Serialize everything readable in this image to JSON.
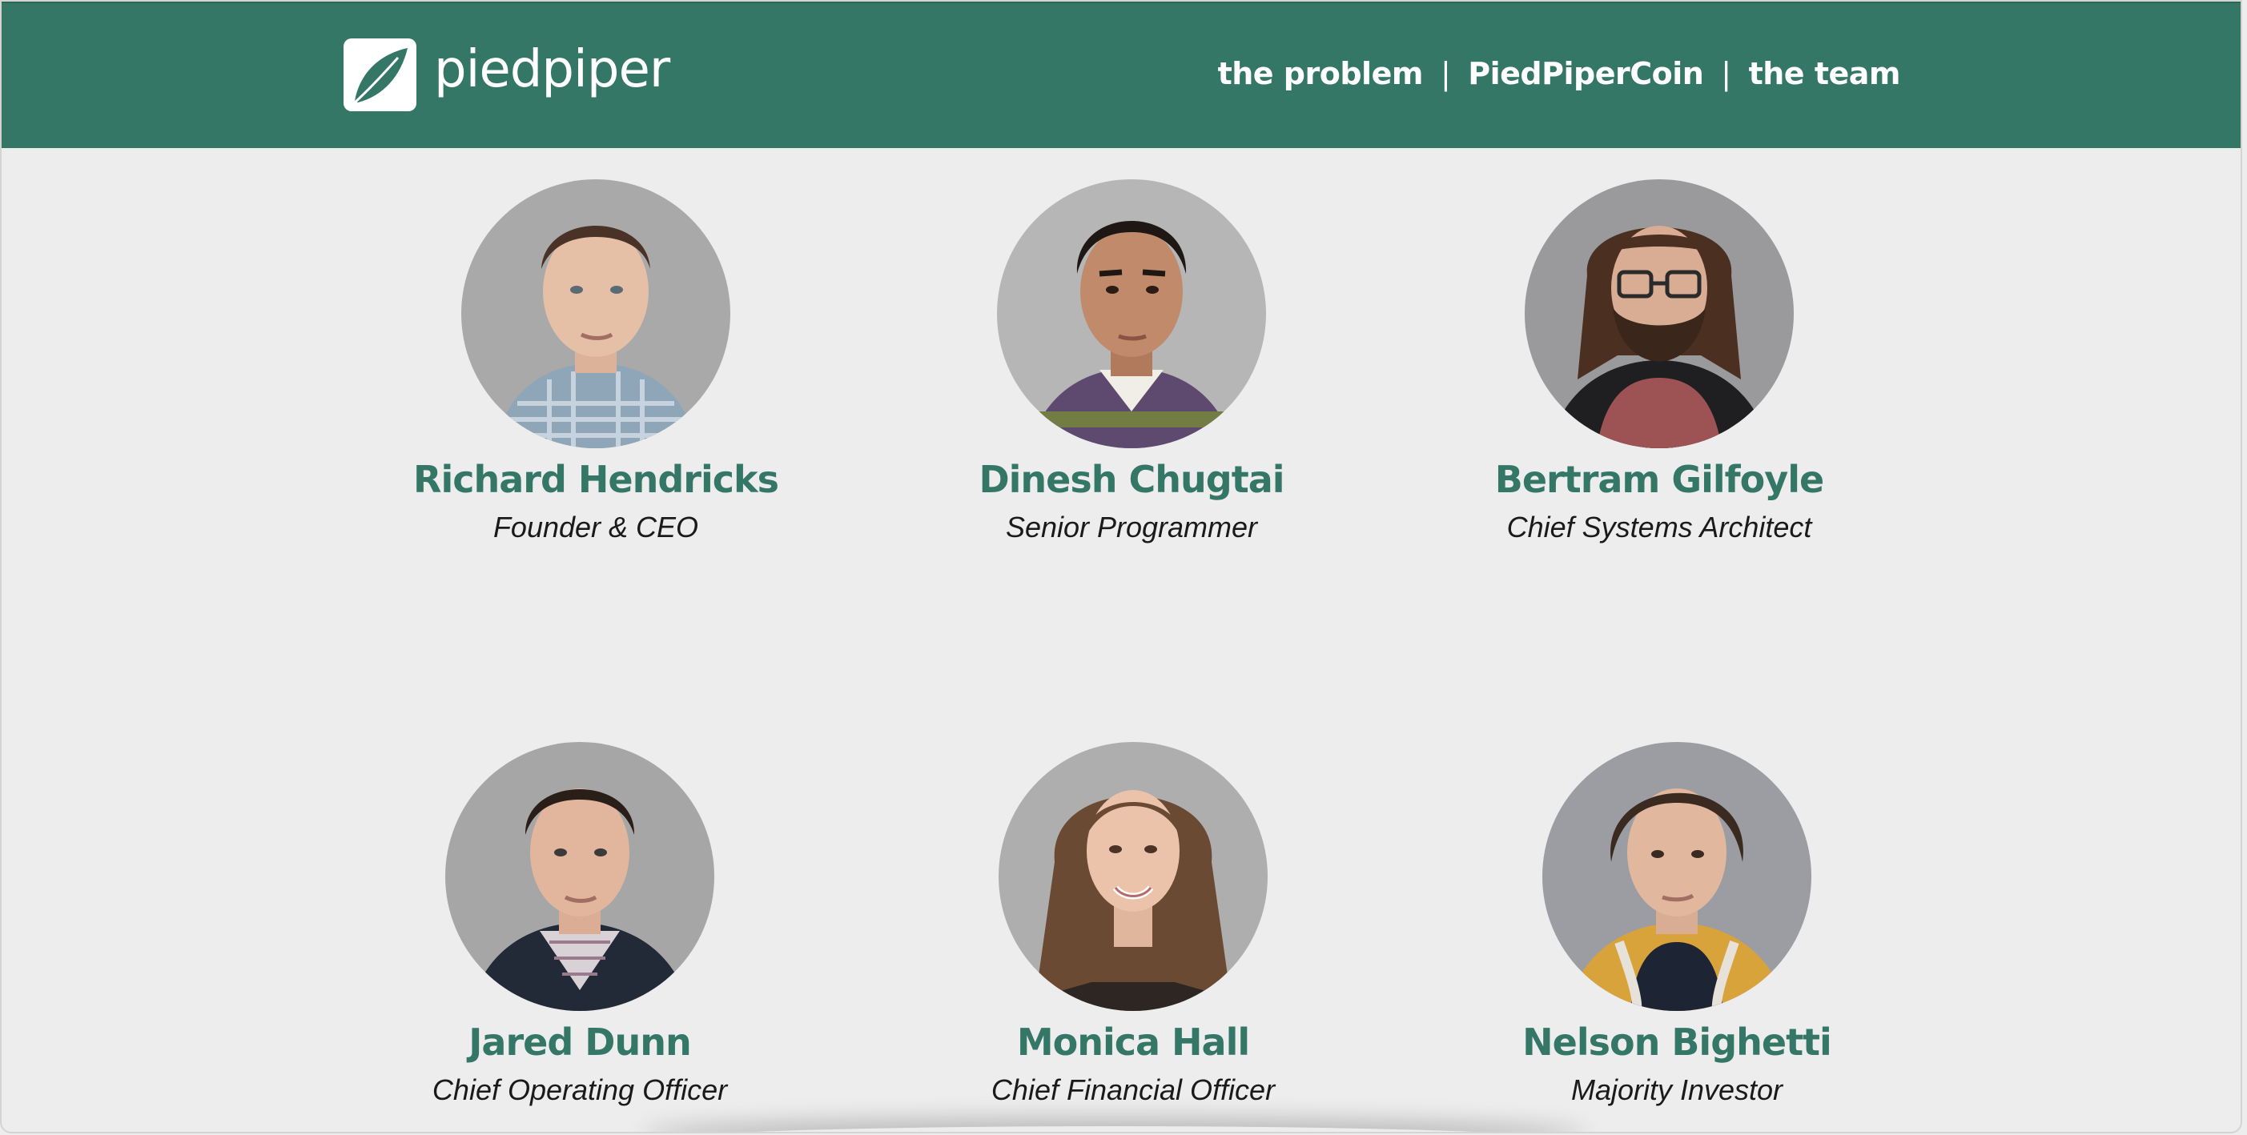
{
  "brand": {
    "name": "piedpiper",
    "primary_color": "#357767",
    "logo_icon": "leaf-icon"
  },
  "nav": {
    "items": [
      {
        "label": "the problem"
      },
      {
        "label": "PiedPiperCoin"
      },
      {
        "label": "the team"
      }
    ],
    "separator": "|"
  },
  "team": [
    {
      "name": "Richard Hendricks",
      "role": "Founder & CEO",
      "icon": "richard-hendricks-portrait"
    },
    {
      "name": "Dinesh Chugtai",
      "role": "Senior Programmer",
      "icon": "dinesh-chugtai-portrait"
    },
    {
      "name": "Bertram Gilfoyle",
      "role": "Chief Systems Architect",
      "icon": "bertram-gilfoyle-portrait"
    },
    {
      "name": "Jared Dunn",
      "role": "Chief Operating Officer",
      "icon": "jared-dunn-portrait"
    },
    {
      "name": "Monica Hall",
      "role": "Chief Financial Officer",
      "icon": "monica-hall-portrait"
    },
    {
      "name": "Nelson Bighetti",
      "role": "Majority Investor",
      "icon": "nelson-bighetti-portrait"
    }
  ]
}
